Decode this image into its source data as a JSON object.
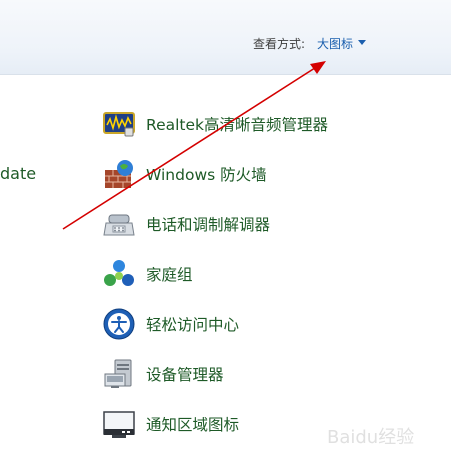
{
  "header": {
    "view_by_label": "查看方式:",
    "view_by_value": "大图标"
  },
  "partial_item": {
    "label": "date"
  },
  "items": [
    {
      "label": "Realtek高清晰音频管理器",
      "icon": "realtek-audio-icon"
    },
    {
      "label": "Windows 防火墙",
      "icon": "firewall-icon"
    },
    {
      "label": "电话和调制解调器",
      "icon": "phone-modem-icon"
    },
    {
      "label": "家庭组",
      "icon": "homegroup-icon"
    },
    {
      "label": "轻松访问中心",
      "icon": "ease-of-access-icon"
    },
    {
      "label": "设备管理器",
      "icon": "device-manager-icon"
    },
    {
      "label": "通知区域图标",
      "icon": "notification-area-icon"
    }
  ],
  "watermark": {
    "text": "Baidu经验"
  },
  "colors": {
    "link": "#1e5a27",
    "accent": "#1b5fae",
    "annotation_arrow": "#d40000"
  }
}
